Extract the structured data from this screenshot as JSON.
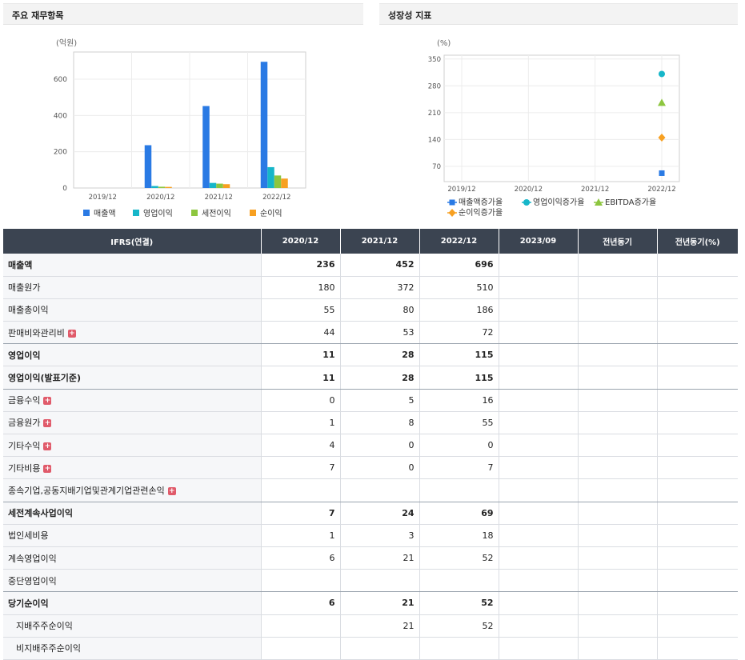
{
  "left_panel": {
    "title": "주요 재무항목",
    "chart_data": {
      "type": "bar",
      "unit_label": "(억원)",
      "categories": [
        "2019/12",
        "2020/12",
        "2021/12",
        "2022/12"
      ],
      "yticks": [
        0,
        200,
        400,
        600
      ],
      "ylim": [
        0,
        750
      ],
      "grid": true,
      "legend_position": "bottom",
      "series": [
        {
          "name": "매출액",
          "color": "#2a7ae4",
          "values": [
            0,
            236,
            452,
            696
          ]
        },
        {
          "name": "영업이익",
          "color": "#16b6c9",
          "values": [
            0,
            11,
            28,
            115
          ]
        },
        {
          "name": "세전이익",
          "color": "#8dc63f",
          "values": [
            0,
            7,
            24,
            69
          ]
        },
        {
          "name": "순이익",
          "color": "#f7a021",
          "values": [
            0,
            6,
            21,
            52
          ]
        }
      ]
    }
  },
  "right_panel": {
    "title": "성장성 지표",
    "chart_data": {
      "type": "scatter",
      "unit_label": "(%)",
      "categories": [
        "2019/12",
        "2020/12",
        "2021/12",
        "2022/12"
      ],
      "yticks": [
        70,
        140,
        210,
        280,
        350
      ],
      "ylim": [
        30,
        360
      ],
      "grid": true,
      "legend_position": "bottom",
      "series": [
        {
          "name": "매출액증가율",
          "color": "#2a7ae4",
          "marker": "square",
          "values": [
            null,
            null,
            null,
            52
          ]
        },
        {
          "name": "영업이익증가율",
          "color": "#16b6c9",
          "marker": "circle",
          "values": [
            null,
            null,
            null,
            311
          ]
        },
        {
          "name": "EBITDA증가율",
          "color": "#8dc63f",
          "marker": "triangle",
          "values": [
            null,
            null,
            null,
            236
          ]
        },
        {
          "name": "순이익증가율",
          "color": "#f7a021",
          "marker": "diamond",
          "values": [
            null,
            null,
            null,
            145
          ]
        }
      ]
    }
  },
  "table": {
    "headers": [
      "IFRS(연결)",
      "2020/12",
      "2021/12",
      "2022/12",
      "2023/09",
      "전년동기",
      "전년동기(%)"
    ],
    "rows": [
      {
        "label": "매출액",
        "bold": true,
        "plus": false,
        "indent": false,
        "sep": false,
        "cells": [
          "236",
          "452",
          "696",
          "",
          "",
          ""
        ]
      },
      {
        "label": "매출원가",
        "bold": false,
        "plus": false,
        "indent": false,
        "sep": false,
        "cells": [
          "180",
          "372",
          "510",
          "",
          "",
          ""
        ]
      },
      {
        "label": "매출총이익",
        "bold": false,
        "plus": false,
        "indent": false,
        "sep": false,
        "cells": [
          "55",
          "80",
          "186",
          "",
          "",
          ""
        ]
      },
      {
        "label": "판매비와관리비",
        "bold": false,
        "plus": true,
        "indent": false,
        "sep": true,
        "cells": [
          "44",
          "53",
          "72",
          "",
          "",
          ""
        ]
      },
      {
        "label": "영업이익",
        "bold": true,
        "plus": false,
        "indent": false,
        "sep": false,
        "cells": [
          "11",
          "28",
          "115",
          "",
          "",
          ""
        ]
      },
      {
        "label": "영업이익(발표기준)",
        "bold": true,
        "plus": false,
        "indent": false,
        "sep": true,
        "cells": [
          "11",
          "28",
          "115",
          "",
          "",
          ""
        ]
      },
      {
        "label": "금융수익",
        "bold": false,
        "plus": true,
        "indent": false,
        "sep": false,
        "cells": [
          "0",
          "5",
          "16",
          "",
          "",
          ""
        ]
      },
      {
        "label": "금융원가",
        "bold": false,
        "plus": true,
        "indent": false,
        "sep": false,
        "cells": [
          "1",
          "8",
          "55",
          "",
          "",
          ""
        ]
      },
      {
        "label": "기타수익",
        "bold": false,
        "plus": true,
        "indent": false,
        "sep": false,
        "cells": [
          "4",
          "0",
          "0",
          "",
          "",
          ""
        ]
      },
      {
        "label": "기타비용",
        "bold": false,
        "plus": true,
        "indent": false,
        "sep": false,
        "cells": [
          "7",
          "0",
          "7",
          "",
          "",
          ""
        ]
      },
      {
        "label": "종속기업,공동지배기업및관계기업관련손익",
        "bold": false,
        "plus": true,
        "indent": false,
        "sep": true,
        "cells": [
          "",
          "",
          "",
          "",
          "",
          ""
        ]
      },
      {
        "label": "세전계속사업이익",
        "bold": true,
        "plus": false,
        "indent": false,
        "sep": false,
        "cells": [
          "7",
          "24",
          "69",
          "",
          "",
          ""
        ]
      },
      {
        "label": "법인세비용",
        "bold": false,
        "plus": false,
        "indent": false,
        "sep": false,
        "cells": [
          "1",
          "3",
          "18",
          "",
          "",
          ""
        ]
      },
      {
        "label": "계속영업이익",
        "bold": false,
        "plus": false,
        "indent": false,
        "sep": false,
        "cells": [
          "6",
          "21",
          "52",
          "",
          "",
          ""
        ]
      },
      {
        "label": "중단영업이익",
        "bold": false,
        "plus": false,
        "indent": false,
        "sep": true,
        "cells": [
          "",
          "",
          "",
          "",
          "",
          ""
        ]
      },
      {
        "label": "당기순이익",
        "bold": true,
        "plus": false,
        "indent": false,
        "sep": false,
        "cells": [
          "6",
          "21",
          "52",
          "",
          "",
          ""
        ]
      },
      {
        "label": "지배주주순이익",
        "bold": false,
        "plus": false,
        "indent": true,
        "sep": false,
        "cells": [
          "",
          "21",
          "52",
          "",
          "",
          ""
        ]
      },
      {
        "label": "비지배주주순이익",
        "bold": false,
        "plus": false,
        "indent": true,
        "sep": false,
        "cells": [
          "",
          "",
          "",
          "",
          "",
          ""
        ]
      }
    ]
  }
}
